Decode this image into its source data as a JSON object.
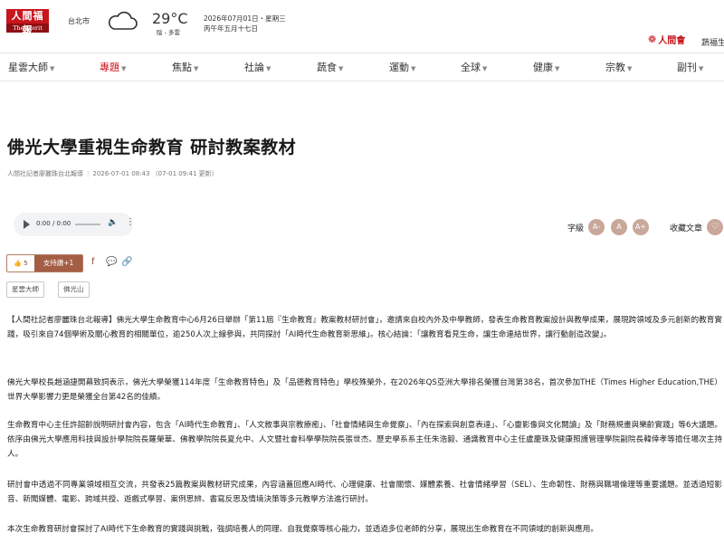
{
  "header": {
    "logo_main": "人間福報",
    "logo_sub": "The Merit Times",
    "city": "台北市",
    "weather_icon": "cloud-icon",
    "temperature": "29°C",
    "weather_desc": "陰 - 多雲",
    "date_gregorian": "2026年07月01日・星期三",
    "date_lunar": "丙午年五月十七日",
    "brand": "人間會",
    "brand_right": "蔬福生"
  },
  "nav": {
    "items": [
      {
        "label": "星雲大師"
      },
      {
        "label": "專題"
      },
      {
        "label": "焦點"
      },
      {
        "label": "社論"
      },
      {
        "label": "蔬食"
      },
      {
        "label": "運動"
      },
      {
        "label": "全球"
      },
      {
        "label": "健康"
      },
      {
        "label": "宗教"
      },
      {
        "label": "副刊"
      }
    ],
    "active_index": 1,
    "active_color": "#c8161d"
  },
  "article": {
    "title": "佛光大學重視生命教育 研討教案教材",
    "byline": "人間社記者廖麗珠台北報導",
    "published": "2026-07-01 08:43",
    "updated": "（07-01 09:41 更新）",
    "audio": {
      "time": "0:00 / 0:00"
    },
    "font_size_label": "字級",
    "font_buttons": [
      "A-",
      "A",
      "A+"
    ],
    "favorite_label": "收藏文章",
    "like": {
      "count": "5",
      "support_label": "支持讚+1"
    },
    "tags": [
      "星雲大師",
      "佛光山"
    ],
    "paragraphs": [
      "【人間社記者廖麗珠台北報導】佛光大學生命教育中心6月26日舉辦「第11屆『生命教育』教案教材研討會」，邀請來自校內外及中學教師，發表生命教育教案設計與教學成果，展現跨領域及多元創新的教育實踐，吸引來自74個學術及關心教育的相關單位，逾250人次上線參與，共同探討「AI時代生命教育新思維」。核心結論：「讓教育看見生命，讓生命連結世界，讓行動創造改變」。",
      "佛光大學校長趙涵捷開幕致詞表示，佛光大學榮獲114年度「生命教育特色」及「品德教育特色」學校殊榮外，在2026年QS亞洲大學排名榮獲台灣第38名，首次參加THE（Times Higher Education,THE）世界大學影響力更是榮獲全台第42名的佳績。",
      "生命教育中心主任許韶齡說明研討會內容，包含「AI時代生命教育」、「人文敘事與宗教療癒」、「社會情緒與生命覺察」、「內在探索與創意表達」、「心靈影像與文化閱讀」及「財務規畫與樂齡實踐」等6大議題。依序由佛光大學應用科技與設計學院院長羅榮華、佛教學院院長夏允中、人文暨社會科學學院院長張世杰、歷史學系系主任朱浩毅、通識教育中心主任盧慶珠及健康照護管理學院副院長韓倖孝等擔任場次主持人。",
      "研討會中透過不同專業領域相互交流，共發表25篇教案與教材研究成果，內容涵蓋回應AI時代、心理健康、社會關懷、媒體素養、社會情緒學習（SEL）、生命韌性、財務與職場倫理等重要議題。並透過短影音、新聞媒體、電影、跨域共授、遊戲式學習、案例思辨、書寫反思及情境決策等多元教學方法進行研討。",
      "本次生命教育研討會探討了AI時代下生命教育的實踐與挑戰，強調培養人的同理、自我覺察等核心能力，並透過多位老師的分享，展現出生命教育在不同領域的創新與應用。"
    ]
  },
  "colors": {
    "brand_red": "#c8161d",
    "accent_brown": "#a35e44",
    "font_button_bg": "#c9a89b"
  }
}
